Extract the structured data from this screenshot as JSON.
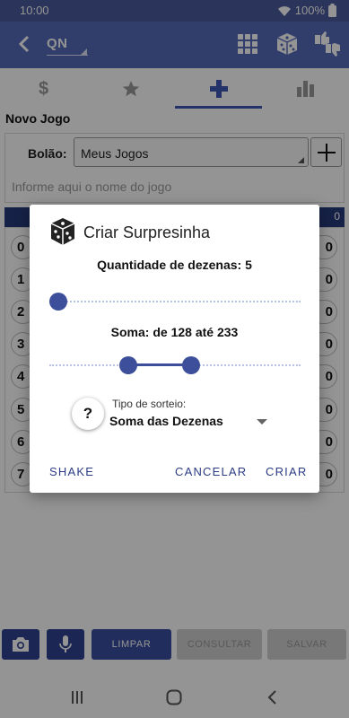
{
  "status": {
    "time": "10:00",
    "battery": "100%"
  },
  "app_bar": {
    "lottery": "QN",
    "icons": [
      "back-arrow-icon",
      "grid-icon",
      "dice-icon",
      "thumbs-icon"
    ]
  },
  "tabs": [
    {
      "icon": "dollar-icon"
    },
    {
      "icon": "star-icon"
    },
    {
      "icon": "plus-icon",
      "selected": true
    },
    {
      "icon": "bar-chart-icon"
    }
  ],
  "section_title": "Novo Jogo",
  "form": {
    "bolao_label": "Bolão:",
    "bolao_value": "Meus Jogos",
    "name_placeholder": "Informe aqui o nome do jogo"
  },
  "numbers": {
    "left": [
      "0",
      "1",
      "2",
      "3",
      "4",
      "5",
      "6",
      "7"
    ],
    "right_partial": [
      "0",
      "0",
      "0",
      "0",
      "0",
      "0",
      "0",
      "0"
    ],
    "header_tail": "0"
  },
  "dialog": {
    "title": "Criar Surpresinha",
    "quantidade_label": "Quantidade de dezenas: 5",
    "quantidade_slider": {
      "value": 5,
      "fraction": 0.0
    },
    "soma_label": "Soma: de 128 até 233",
    "soma_range": {
      "low": 128,
      "high": 233,
      "low_fraction": 0.3,
      "high_fraction": 0.57
    },
    "tipo_label": "Tipo de sorteio:",
    "tipo_value": "Soma das Dezenas",
    "help_symbol": "?",
    "buttons": {
      "shake": "SHAKE",
      "cancelar": "CANCELAR",
      "criar": "CRIAR"
    }
  },
  "bottom": {
    "limpar": "LIMPAR",
    "consultar": "CONSULTAR",
    "salvar": "SALVAR"
  },
  "colors": {
    "primary": "#5569b8",
    "status_bar": "#4a5b9c",
    "dark": "#2f4391",
    "accent_text": "#2c3c86"
  }
}
